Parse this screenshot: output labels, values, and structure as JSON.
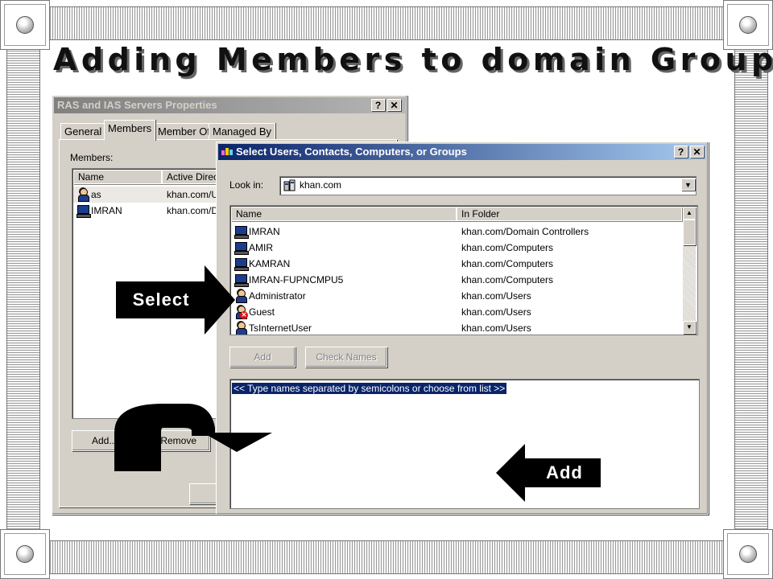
{
  "slide": {
    "title": "Adding Members to domain Groups"
  },
  "properties_dialog": {
    "title": "RAS and IAS Servers Properties",
    "help_btn": "?",
    "close_btn": "✕",
    "tabs": [
      "General",
      "Members",
      "Member Of",
      "Managed By"
    ],
    "active_tab": "Members",
    "members_label": "Members:",
    "columns": [
      "Name",
      "Active Direc"
    ],
    "rows": [
      {
        "name": "as",
        "folder": "khan.com/U",
        "icon": "user-icon"
      },
      {
        "name": "IMRAN",
        "folder": "khan.com/D",
        "icon": "computer-icon"
      }
    ],
    "add_btn": "Add...",
    "remove_btn": "Remove"
  },
  "select_dialog": {
    "title": "Select Users, Contacts, Computers, or Groups",
    "help_btn": "?",
    "close_btn": "✕",
    "look_in_label": "Look in:",
    "look_in_value": "khan.com",
    "columns": [
      "Name",
      "In Folder"
    ],
    "rows": [
      {
        "name": "IMRAN",
        "folder": "khan.com/Domain Controllers",
        "icon": "computer-icon"
      },
      {
        "name": "AMIR",
        "folder": "khan.com/Computers",
        "icon": "computer-icon"
      },
      {
        "name": "KAMRAN",
        "folder": "khan.com/Computers",
        "icon": "computer-icon"
      },
      {
        "name": "IMRAN-FUPNCMPU5",
        "folder": "khan.com/Computers",
        "icon": "computer-icon"
      },
      {
        "name": "Administrator",
        "folder": "khan.com/Users",
        "icon": "user-icon"
      },
      {
        "name": "Guest",
        "folder": "khan.com/Users",
        "icon": "disabled-user-icon"
      },
      {
        "name": "TsInternetUser",
        "folder": "khan.com/Users",
        "icon": "user-icon"
      }
    ],
    "add_btn": "Add",
    "check_names_btn": "Check Names",
    "names_placeholder": "<< Type names separated by semicolons or choose from list >>"
  },
  "annotations": {
    "select_label": "Select",
    "add_label": "Add"
  },
  "colors": {
    "active_title": "#0a246a",
    "selection": "#0a246a",
    "dialog_face": "#d4d0c8"
  }
}
